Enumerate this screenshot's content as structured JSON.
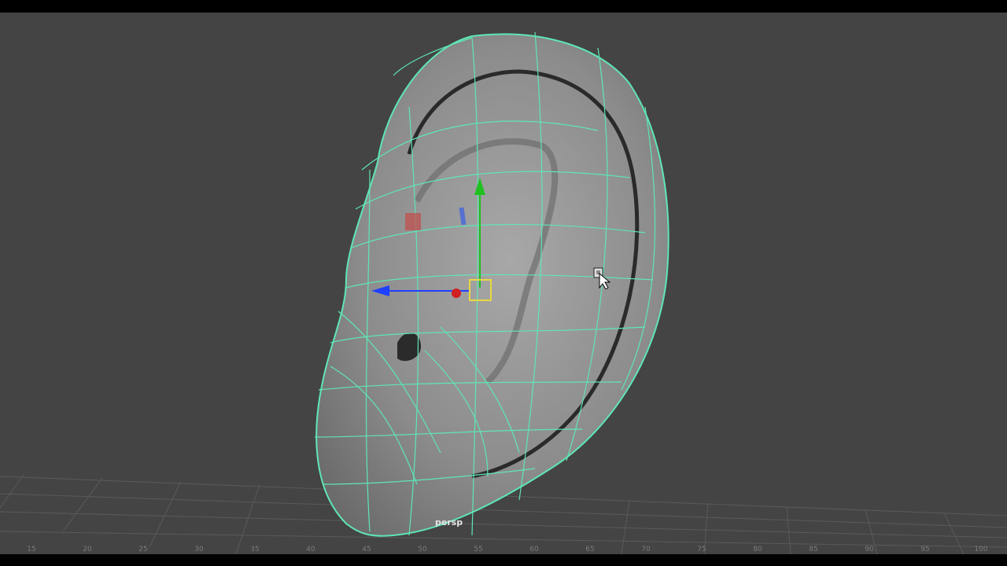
{
  "viewport": {
    "camera_label": "persp",
    "background_color": "#444444",
    "wireframe_color": "#5fe6b4",
    "ground_grid": true
  },
  "manipulator": {
    "tool": "move-tool",
    "x_axis_color": "#d02020",
    "y_axis_color": "#20c020",
    "z_axis_color": "#2040ff",
    "center_handle_color": "#e8d840"
  },
  "timeline": {
    "ticks": [
      "15",
      "20",
      "25",
      "30",
      "35",
      "40",
      "45",
      "50",
      "55",
      "60",
      "65",
      "70",
      "75",
      "80",
      "85",
      "90",
      "95",
      "100"
    ]
  }
}
